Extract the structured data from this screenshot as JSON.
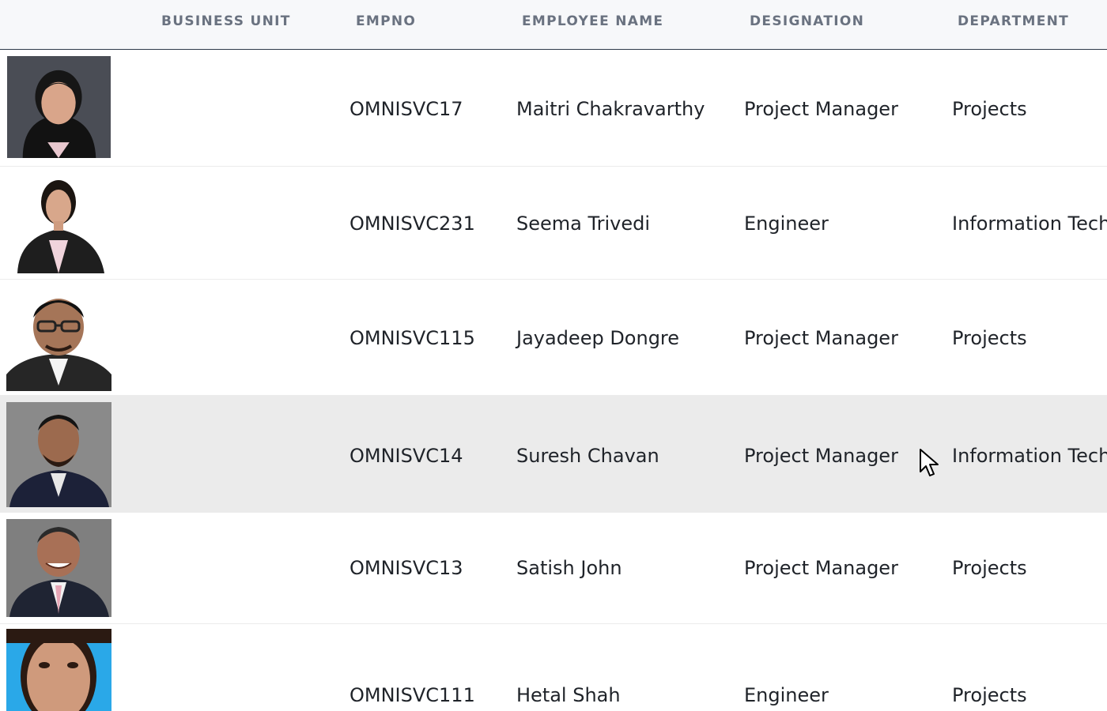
{
  "columns": {
    "business_unit": "BUSINESS UNIT",
    "empno": "EMPNO",
    "employee_name": "EMPLOYEE NAME",
    "designation": "DESIGNATION",
    "department": "DEPARTMENT"
  },
  "rows": [
    {
      "empno": "OMNISVC17",
      "name": "Maitri Chakravarthy",
      "designation": "Project Manager",
      "department": "Projects",
      "business_unit": ""
    },
    {
      "empno": "OMNISVC231",
      "name": "Seema Trivedi",
      "designation": "Engineer",
      "department": "Information Techn",
      "business_unit": ""
    },
    {
      "empno": "OMNISVC115",
      "name": "Jayadeep Dongre",
      "designation": "Project Manager",
      "department": "Projects",
      "business_unit": ""
    },
    {
      "empno": "OMNISVC14",
      "name": "Suresh Chavan",
      "designation": "Project Manager",
      "department": "Information Techn",
      "business_unit": ""
    },
    {
      "empno": "OMNISVC13",
      "name": "Satish John",
      "designation": "Project Manager",
      "department": "Projects",
      "business_unit": ""
    },
    {
      "empno": "OMNISVC111",
      "name": "Hetal Shah",
      "designation": "Engineer",
      "department": "Projects",
      "business_unit": ""
    }
  ],
  "hovered_row": 3,
  "colors": {
    "header_bg": "#f7f8fa",
    "header_text": "#6a7280",
    "header_border": "#2f3a4a",
    "row_hover_bg": "#ebebeb",
    "cell_text": "#1f2329"
  },
  "icons": {
    "cursor": "mouse-pointer-icon"
  }
}
